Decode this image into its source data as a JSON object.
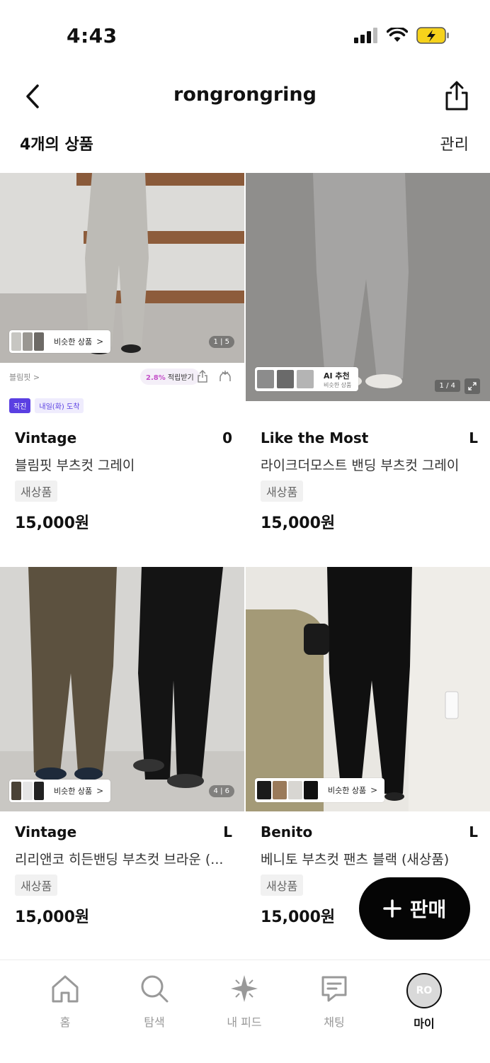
{
  "status": {
    "time": "4:43"
  },
  "nav": {
    "title": "rongrongring"
  },
  "list": {
    "count_label": "4개의 상품",
    "manage_label": "관리"
  },
  "products": [
    {
      "brand": "Vintage",
      "size": "0",
      "title": "블림핏 부츠컷 그레이",
      "condition": "새상품",
      "price": "15,000원",
      "image_counter": "1 | 5",
      "similar_label": "비슷한 상품"
    },
    {
      "brand": "Like the Most",
      "size": "L",
      "title": "라이크더모스트 밴딩 부츠컷 그레이",
      "condition": "새상품",
      "price": "15,000원",
      "image_counter": "1 / 4",
      "ai_label": "AI 추천",
      "ai_sub": "비슷한 상품"
    },
    {
      "brand": "Vintage",
      "size": "L",
      "title": "리리앤코 히든밴딩 부츠컷 브라운 (...",
      "condition": "새상품",
      "price": "15,000원",
      "image_counter": "4 | 6",
      "similar_label": "비슷한 상품"
    },
    {
      "brand": "Benito",
      "size": "L",
      "title": "베니토 부츠컷 팬츠 블랙 (새상품)",
      "condition": "새상품",
      "price": "15,000원",
      "similar_label": "비슷한 상품"
    }
  ],
  "ad": {
    "brand": "블림핏 >",
    "reward_pct": "2.8%",
    "reward_label": "적립받기",
    "direct_label": "직진",
    "delivery_label": "내일(화) 도착"
  },
  "fab": {
    "label": "판매"
  },
  "tabs": [
    {
      "label": "홈",
      "icon": "home-icon"
    },
    {
      "label": "탐색",
      "icon": "search-icon"
    },
    {
      "label": "내 피드",
      "icon": "sparkle-icon"
    },
    {
      "label": "채팅",
      "icon": "chat-icon"
    },
    {
      "label": "마이",
      "icon": "avatar",
      "avatar_text": "RO"
    }
  ],
  "colors": {
    "accent": "#5a3fe2",
    "fab": "#050505",
    "reward": "#c451c9"
  }
}
